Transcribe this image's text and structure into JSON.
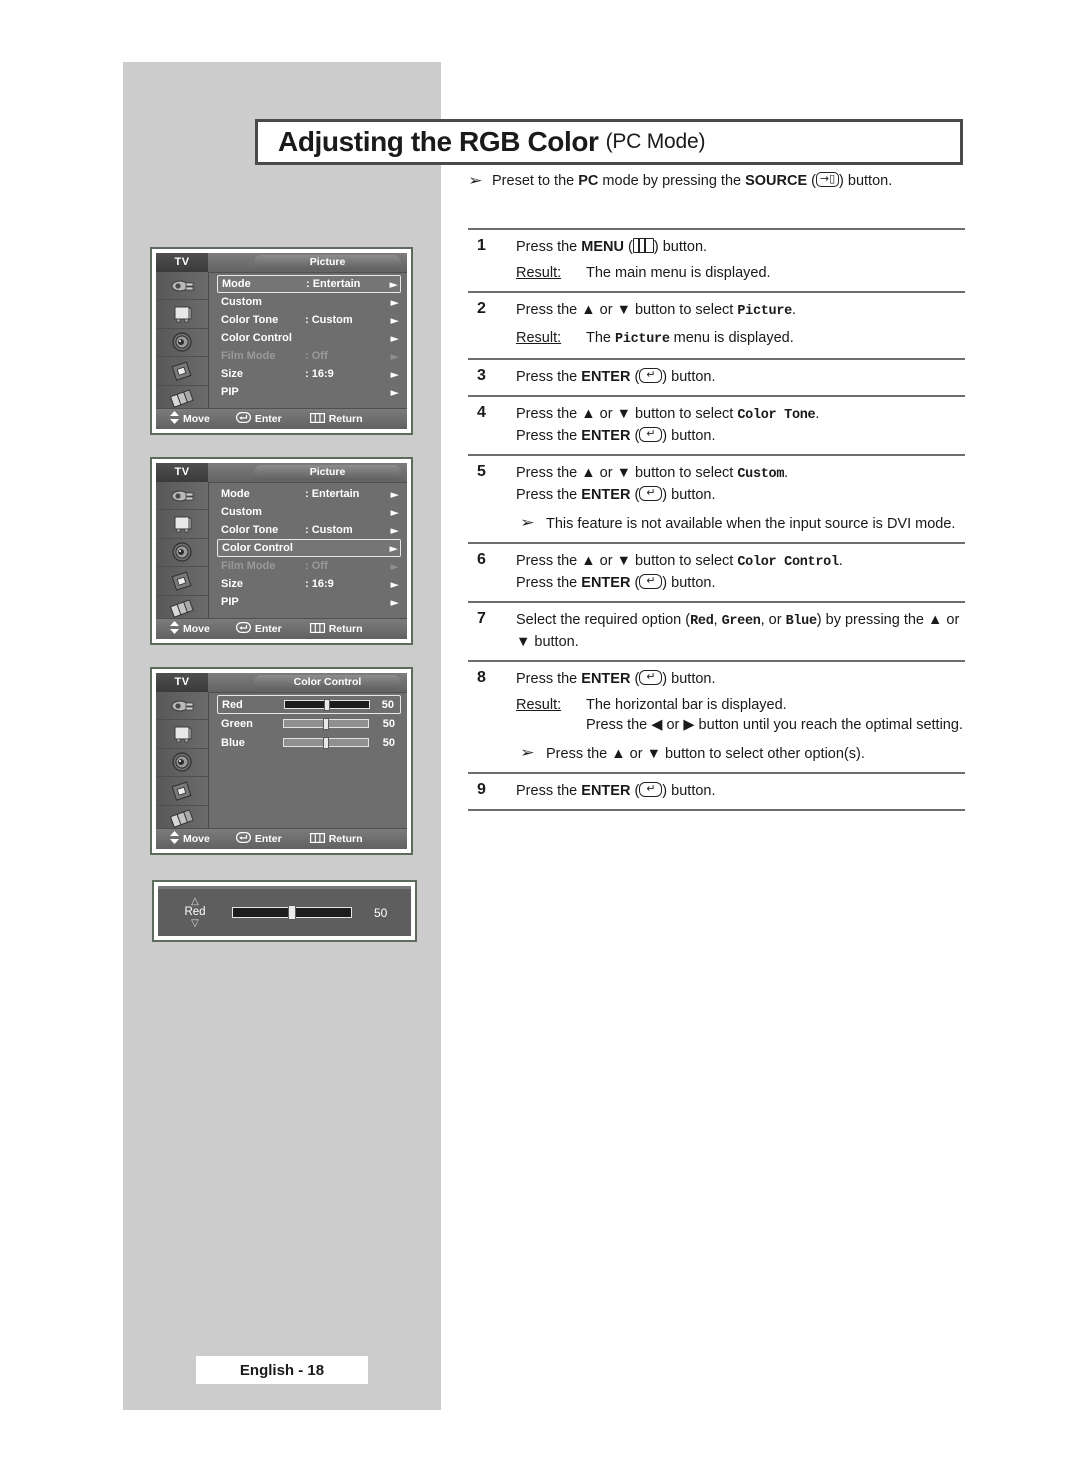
{
  "page": {
    "title_main": "Adjusting the RGB Color",
    "title_sub": "(PC Mode)",
    "footer": "English - 18"
  },
  "top_note": {
    "bullet": "➢",
    "text_before": "Preset to the ",
    "bold1": "PC",
    "text_mid": " mode by pressing the ",
    "bold2": "SOURCE",
    "icon": "source-icon",
    "text_after": " button."
  },
  "steps": [
    {
      "num": "1",
      "lines": [
        {
          "pre": "Press the ",
          "bold": "MENU",
          "icon": "menu-icon",
          "post": " button."
        }
      ],
      "result": {
        "label": "Result:",
        "text": "The main menu is displayed."
      }
    },
    {
      "num": "2",
      "lines": [
        {
          "pre": "Press the ▲ or ▼ button to select ",
          "mono": "Picture",
          "post": "."
        }
      ],
      "result": {
        "label": "Result:",
        "pre": "The ",
        "mono": "Picture",
        "post": " menu is displayed."
      }
    },
    {
      "num": "3",
      "lines": [
        {
          "pre": "Press the ",
          "bold": "ENTER",
          "icon": "enter-icon",
          "post": " button."
        }
      ]
    },
    {
      "num": "4",
      "lines": [
        {
          "pre": "Press the ▲ or ▼ button to select ",
          "mono": "Color Tone",
          "post": "."
        },
        {
          "pre": "Press the ",
          "bold": "ENTER",
          "icon": "enter-icon",
          "post": " button."
        }
      ]
    },
    {
      "num": "5",
      "lines": [
        {
          "pre": "Press the ▲ or ▼ button to select ",
          "mono": "Custom",
          "post": "."
        },
        {
          "pre": "Press the ",
          "bold": "ENTER",
          "icon": "enter-icon",
          "post": " button."
        }
      ],
      "note": {
        "bullet": "➢",
        "text": "This feature is not available when the input source is DVI mode."
      }
    },
    {
      "num": "6",
      "lines": [
        {
          "pre": "Press the ▲ or ▼ button to select ",
          "mono": "Color Control",
          "post": "."
        },
        {
          "pre": "Press the ",
          "bold": "ENTER",
          "icon": "enter-icon",
          "post": " button."
        }
      ]
    },
    {
      "num": "7",
      "lines": [
        {
          "pre": "Select the required option (",
          "mono": "Red",
          "post": ", "
        },
        {
          "mono2": "Green",
          "mono3": "Blue",
          "tail": ") by pressing the ▲ or ▼ button."
        }
      ]
    },
    {
      "num": "8",
      "lines": [
        {
          "pre": "Press the ",
          "bold": "ENTER",
          "icon": "enter-icon",
          "post": " button."
        }
      ],
      "result": {
        "label": "Result:",
        "line1": "The horizontal bar is displayed.",
        "line2": "Press the ◀ or ▶ button until you reach the optimal setting."
      },
      "note": {
        "bullet": "➢",
        "text": "Press the ▲ or ▼ button to select other option(s)."
      }
    },
    {
      "num": "9",
      "lines": [
        {
          "pre": "Press the ",
          "bold": "ENTER",
          "icon": "enter-icon",
          "post": " button."
        }
      ]
    }
  ],
  "osd_common": {
    "tv_label": "TV",
    "footer": {
      "move": "Move",
      "enter": "Enter",
      "return": "Return"
    },
    "rail_icons": [
      "input-connector-icon",
      "tv-picture-icon",
      "speaker-sound-icon",
      "setup-chip-icon",
      "pip-pages-icon"
    ]
  },
  "osd1": {
    "title": "Picture",
    "rows": [
      {
        "label": "Mode",
        "value": ": Entertain",
        "selected": true,
        "dim": false
      },
      {
        "label": "Custom",
        "value": "",
        "selected": false,
        "dim": false
      },
      {
        "label": "Color Tone",
        "value": ": Custom",
        "selected": false,
        "dim": false
      },
      {
        "label": "Color Control",
        "value": "",
        "selected": false,
        "dim": false
      },
      {
        "label": "Film Mode",
        "value": ": Off",
        "selected": false,
        "dim": true
      },
      {
        "label": "Size",
        "value": ": 16:9",
        "selected": false,
        "dim": false
      },
      {
        "label": "PIP",
        "value": "",
        "selected": false,
        "dim": false
      }
    ]
  },
  "osd2": {
    "title": "Picture",
    "rows": [
      {
        "label": "Mode",
        "value": ": Entertain",
        "selected": false,
        "dim": false
      },
      {
        "label": "Custom",
        "value": "",
        "selected": false,
        "dim": false
      },
      {
        "label": "Color Tone",
        "value": ": Custom",
        "selected": false,
        "dim": false
      },
      {
        "label": "Color Control",
        "value": "",
        "selected": true,
        "dim": false
      },
      {
        "label": "Film Mode",
        "value": ": Off",
        "selected": false,
        "dim": true
      },
      {
        "label": "Size",
        "value": ": 16:9",
        "selected": false,
        "dim": false
      },
      {
        "label": "PIP",
        "value": "",
        "selected": false,
        "dim": false
      }
    ]
  },
  "osd3": {
    "title": "Color Control",
    "sliders": [
      {
        "name": "Red",
        "value": "50",
        "percent": 50,
        "selected": true
      },
      {
        "name": "Green",
        "value": "50",
        "percent": 50,
        "selected": false
      },
      {
        "name": "Blue",
        "value": "50",
        "percent": 50,
        "selected": false
      }
    ]
  },
  "bar_widget": {
    "name": "Red",
    "up_arrow": "△",
    "down_arrow": "▽",
    "value": "50",
    "percent": 50
  },
  "colors": {
    "panel_gray": "#cccccc",
    "bezel": "#5c6b5c",
    "osd_bg": "#6e6e6e",
    "rule": "#6d6d6d"
  }
}
